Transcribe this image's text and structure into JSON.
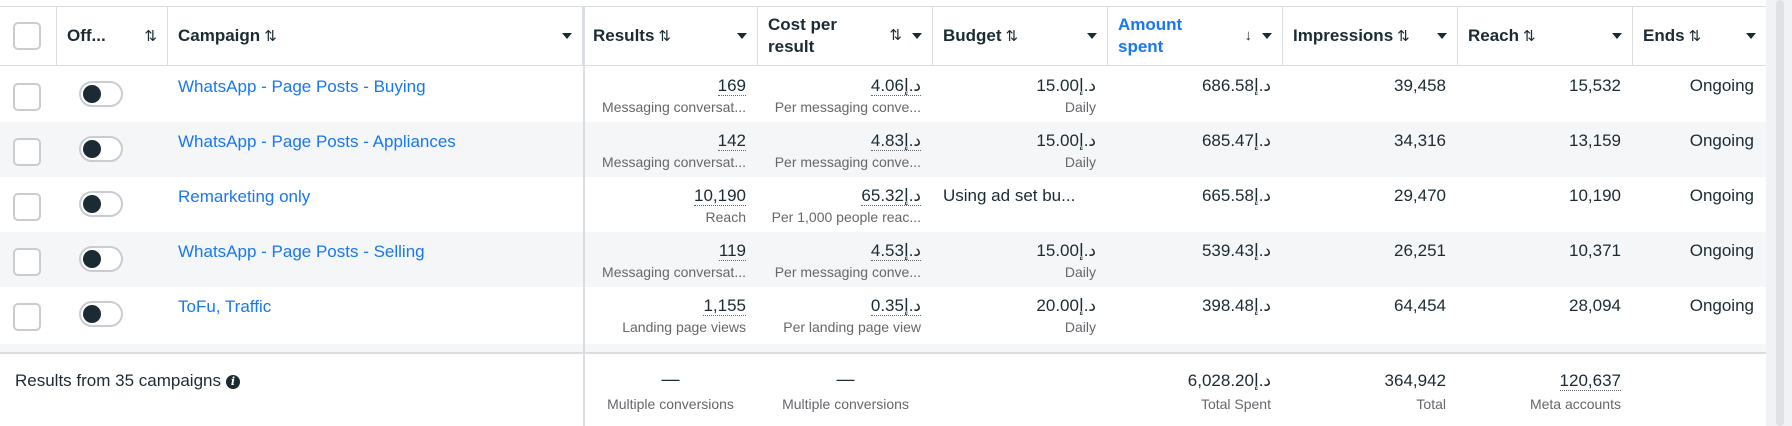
{
  "header": {
    "off_label": "Off...",
    "campaign_label": "Campaign",
    "results_label": "Results",
    "cpr_label_1": "Cost per",
    "cpr_label_2": "result",
    "budget_label": "Budget",
    "amount_label_1": "Amount",
    "amount_label_2": "spent",
    "impressions_label": "Impressions",
    "reach_label": "Reach",
    "ends_label": "Ends",
    "sort_both": "⇅",
    "sort_down": "↓"
  },
  "rows": [
    {
      "name": "WhatsApp - Page Posts - Buying",
      "results": "169",
      "results_sub": "Messaging conversat...",
      "cpr": "4.06د.إ",
      "cpr_sub": "Per messaging conve...",
      "budget": "15.00د.إ",
      "budget_sub": "Daily",
      "amount": "686.58د.إ",
      "impressions": "39,458",
      "reach": "15,532",
      "ends": "Ongoing"
    },
    {
      "name": "WhatsApp - Page Posts - Appliances",
      "results": "142",
      "results_sub": "Messaging conversat...",
      "cpr": "4.83د.إ",
      "cpr_sub": "Per messaging conve...",
      "budget": "15.00د.إ",
      "budget_sub": "Daily",
      "amount": "685.47د.إ",
      "impressions": "34,316",
      "reach": "13,159",
      "ends": "Ongoing"
    },
    {
      "name": "Remarketing only",
      "results": "10,190",
      "results_sub": "Reach",
      "cpr": "65.32د.إ",
      "cpr_sub": "Per 1,000 people reac...",
      "budget": "Using ad set bu...",
      "budget_sub": "",
      "amount": "665.58د.إ",
      "impressions": "29,470",
      "reach": "10,190",
      "ends": "Ongoing"
    },
    {
      "name": "WhatsApp - Page Posts - Selling",
      "results": "119",
      "results_sub": "Messaging conversat...",
      "cpr": "4.53د.إ",
      "cpr_sub": "Per messaging conve...",
      "budget": "15.00د.إ",
      "budget_sub": "Daily",
      "amount": "539.43د.إ",
      "impressions": "26,251",
      "reach": "10,371",
      "ends": "Ongoing"
    },
    {
      "name": "ToFu, Traffic",
      "results": "1,155",
      "results_sub": "Landing page views",
      "cpr": "0.35د.إ",
      "cpr_sub": "Per landing page view",
      "budget": "20.00د.إ",
      "budget_sub": "Daily",
      "amount": "398.48د.إ",
      "impressions": "64,454",
      "reach": "28,094",
      "ends": "Ongoing"
    }
  ],
  "footer": {
    "label": "Results from 35 campaigns",
    "info_glyph": "i",
    "results_dash": "—",
    "results_sub": "Multiple conversions",
    "cpr_dash": "—",
    "cpr_sub": "Multiple conversions",
    "amount": "6,028.20د.إ",
    "amount_sub": "Total Spent",
    "impressions": "364,942",
    "impressions_sub": "Total",
    "reach": "120,637",
    "reach_sub": "Meta accounts"
  }
}
